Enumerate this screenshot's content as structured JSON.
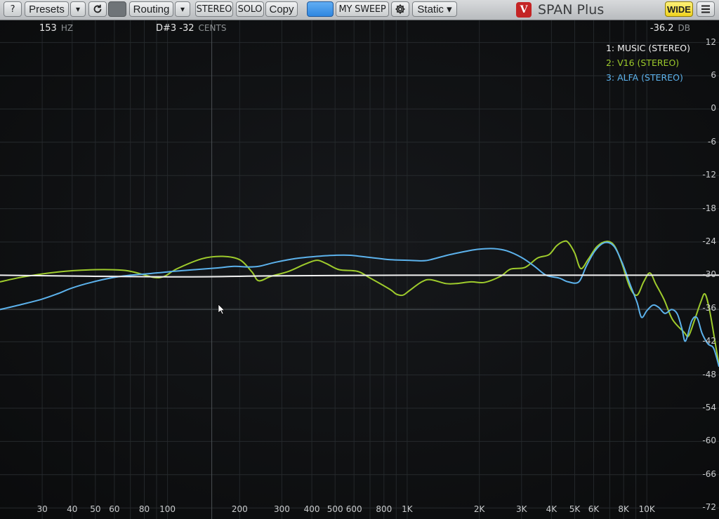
{
  "toolbar": {
    "help_label": "?",
    "presets_label": "Presets",
    "presets_dropdown_glyph": "▾",
    "routing_label": "Routing",
    "routing_dropdown_glyph": "▾",
    "stereo_label": "STEREO",
    "solo_label": "SOLO",
    "copy_label": "Copy",
    "sweep_label": "MY SWEEP",
    "static_label": "Static ▾",
    "wide_label": "WIDE",
    "logo_letter": "V",
    "app_title": "SPAN Plus",
    "icons": [
      "help",
      "dropdown-arrow",
      "undo-icon",
      "gear-icon",
      "menu-icon"
    ]
  },
  "readouts": {
    "frequency_value": "153",
    "frequency_unit": "HZ",
    "note_value": "D#3 -32",
    "note_unit": "CENTS",
    "level_value": "-36.2",
    "level_unit": "DB"
  },
  "legend": {
    "items": [
      {
        "label": "1: MUSIC (STEREO)",
        "color": "#f2f2f2"
      },
      {
        "label": "2: V16 (STEREO)",
        "color": "#9ecb2c"
      },
      {
        "label": "3: ALFA (STEREO)",
        "color": "#5cb2ec"
      }
    ]
  },
  "chart_data": {
    "type": "line",
    "x_scale": "log",
    "xlabel": "",
    "ylabel": "",
    "xlim": [
      20,
      20000
    ],
    "ylim": [
      -74,
      16
    ],
    "x_ticks": [
      {
        "v": 30,
        "label": "30"
      },
      {
        "v": 40,
        "label": "40"
      },
      {
        "v": 50,
        "label": "50"
      },
      {
        "v": 60,
        "label": "60"
      },
      {
        "v": 80,
        "label": "80"
      },
      {
        "v": 100,
        "label": "100"
      },
      {
        "v": 200,
        "label": "200"
      },
      {
        "v": 300,
        "label": "300"
      },
      {
        "v": 400,
        "label": "400"
      },
      {
        "v": 500,
        "label": "500"
      },
      {
        "v": 600,
        "label": "600"
      },
      {
        "v": 800,
        "label": "800"
      },
      {
        "v": 1000,
        "label": "1K"
      },
      {
        "v": 2000,
        "label": "2K"
      },
      {
        "v": 3000,
        "label": "3K"
      },
      {
        "v": 4000,
        "label": "4K"
      },
      {
        "v": 5000,
        "label": "5K"
      },
      {
        "v": 6000,
        "label": "6K"
      },
      {
        "v": 8000,
        "label": "8K"
      },
      {
        "v": 10000,
        "label": "10K"
      }
    ],
    "y_ticks": [
      12,
      6,
      0,
      -6,
      -12,
      -18,
      -24,
      -30,
      -36,
      -42,
      -48,
      -54,
      -60,
      -66,
      -72
    ],
    "grid": true,
    "cursor": {
      "freq": 153,
      "db": -36.2
    },
    "series": [
      {
        "name": "1: MUSIC (STEREO)",
        "color": "#f2f2f2",
        "points": [
          [
            20,
            -30.0
          ],
          [
            100,
            -30.3
          ],
          [
            300,
            -30.1
          ],
          [
            1000,
            -30.0
          ],
          [
            3000,
            -30.0
          ],
          [
            10000,
            -30.0
          ],
          [
            20000,
            -30.0
          ]
        ]
      },
      {
        "name": "2: V16 (STEREO)",
        "color": "#9ecb2c",
        "points": [
          [
            20,
            -31.2
          ],
          [
            25,
            -30.3
          ],
          [
            35,
            -29.4
          ],
          [
            50,
            -29.0
          ],
          [
            65,
            -29.1
          ],
          [
            75,
            -29.6
          ],
          [
            88,
            -30.4
          ],
          [
            97,
            -30.2
          ],
          [
            110,
            -28.8
          ],
          [
            140,
            -27.0
          ],
          [
            170,
            -26.6
          ],
          [
            200,
            -27.2
          ],
          [
            225,
            -29.4
          ],
          [
            240,
            -31.0
          ],
          [
            270,
            -30.2
          ],
          [
            320,
            -29.3
          ],
          [
            375,
            -28.0
          ],
          [
            420,
            -27.3
          ],
          [
            460,
            -27.9
          ],
          [
            520,
            -29.0
          ],
          [
            620,
            -29.3
          ],
          [
            700,
            -30.5
          ],
          [
            850,
            -32.6
          ],
          [
            900,
            -33.4
          ],
          [
            960,
            -33.6
          ],
          [
            1020,
            -32.8
          ],
          [
            1150,
            -31.2
          ],
          [
            1250,
            -30.8
          ],
          [
            1450,
            -31.5
          ],
          [
            1600,
            -31.5
          ],
          [
            1850,
            -31.2
          ],
          [
            2100,
            -31.3
          ],
          [
            2450,
            -30.2
          ],
          [
            2700,
            -28.9
          ],
          [
            3100,
            -28.6
          ],
          [
            3500,
            -26.9
          ],
          [
            3900,
            -26.3
          ],
          [
            4200,
            -24.7
          ],
          [
            4500,
            -23.9
          ],
          [
            4700,
            -24.1
          ],
          [
            5000,
            -26.0
          ],
          [
            5300,
            -28.8
          ],
          [
            5700,
            -27.1
          ],
          [
            6200,
            -24.8
          ],
          [
            6800,
            -23.9
          ],
          [
            7300,
            -24.6
          ],
          [
            7800,
            -27.4
          ],
          [
            8500,
            -32.2
          ],
          [
            9100,
            -33.6
          ],
          [
            9700,
            -31.2
          ],
          [
            10300,
            -29.6
          ],
          [
            10900,
            -31.6
          ],
          [
            11800,
            -34.4
          ],
          [
            12800,
            -38.0
          ],
          [
            14300,
            -40.3
          ],
          [
            14900,
            -41.0
          ],
          [
            15700,
            -38.5
          ],
          [
            16800,
            -34.8
          ],
          [
            17500,
            -33.4
          ],
          [
            18300,
            -36.5
          ],
          [
            19300,
            -42.3
          ],
          [
            20000,
            -46.2
          ]
        ]
      },
      {
        "name": "3: ALFA (STEREO)",
        "color": "#5cb2ec",
        "points": [
          [
            20,
            -36.2
          ],
          [
            25,
            -35.2
          ],
          [
            30,
            -34.3
          ],
          [
            35,
            -33.3
          ],
          [
            40,
            -32.3
          ],
          [
            48,
            -31.3
          ],
          [
            58,
            -30.5
          ],
          [
            70,
            -30.0
          ],
          [
            85,
            -29.7
          ],
          [
            100,
            -29.4
          ],
          [
            130,
            -29.0
          ],
          [
            160,
            -28.7
          ],
          [
            190,
            -28.4
          ],
          [
            215,
            -28.5
          ],
          [
            240,
            -28.4
          ],
          [
            280,
            -27.7
          ],
          [
            340,
            -27.0
          ],
          [
            420,
            -26.6
          ],
          [
            500,
            -26.4
          ],
          [
            580,
            -26.4
          ],
          [
            700,
            -26.8
          ],
          [
            850,
            -27.2
          ],
          [
            1000,
            -27.3
          ],
          [
            1150,
            -27.4
          ],
          [
            1250,
            -27.2
          ],
          [
            1500,
            -26.3
          ],
          [
            1800,
            -25.6
          ],
          [
            2000,
            -25.3
          ],
          [
            2300,
            -25.2
          ],
          [
            2600,
            -25.6
          ],
          [
            3000,
            -26.8
          ],
          [
            3400,
            -28.4
          ],
          [
            3800,
            -30.0
          ],
          [
            4300,
            -30.5
          ],
          [
            4700,
            -31.2
          ],
          [
            5200,
            -31.2
          ],
          [
            5600,
            -28.3
          ],
          [
            6100,
            -25.5
          ],
          [
            6700,
            -24.1
          ],
          [
            7300,
            -24.8
          ],
          [
            7900,
            -27.8
          ],
          [
            8500,
            -31.6
          ],
          [
            9100,
            -34.9
          ],
          [
            9500,
            -37.6
          ],
          [
            10000,
            -36.4
          ],
          [
            10600,
            -35.4
          ],
          [
            11200,
            -35.8
          ],
          [
            11900,
            -36.9
          ],
          [
            12700,
            -36.2
          ],
          [
            13400,
            -37.0
          ],
          [
            14000,
            -39.6
          ],
          [
            14500,
            -41.9
          ],
          [
            15400,
            -38.2
          ],
          [
            16200,
            -37.7
          ],
          [
            17000,
            -40.5
          ],
          [
            18000,
            -42.4
          ],
          [
            19000,
            -43.2
          ],
          [
            20000,
            -46.5
          ]
        ]
      }
    ]
  }
}
